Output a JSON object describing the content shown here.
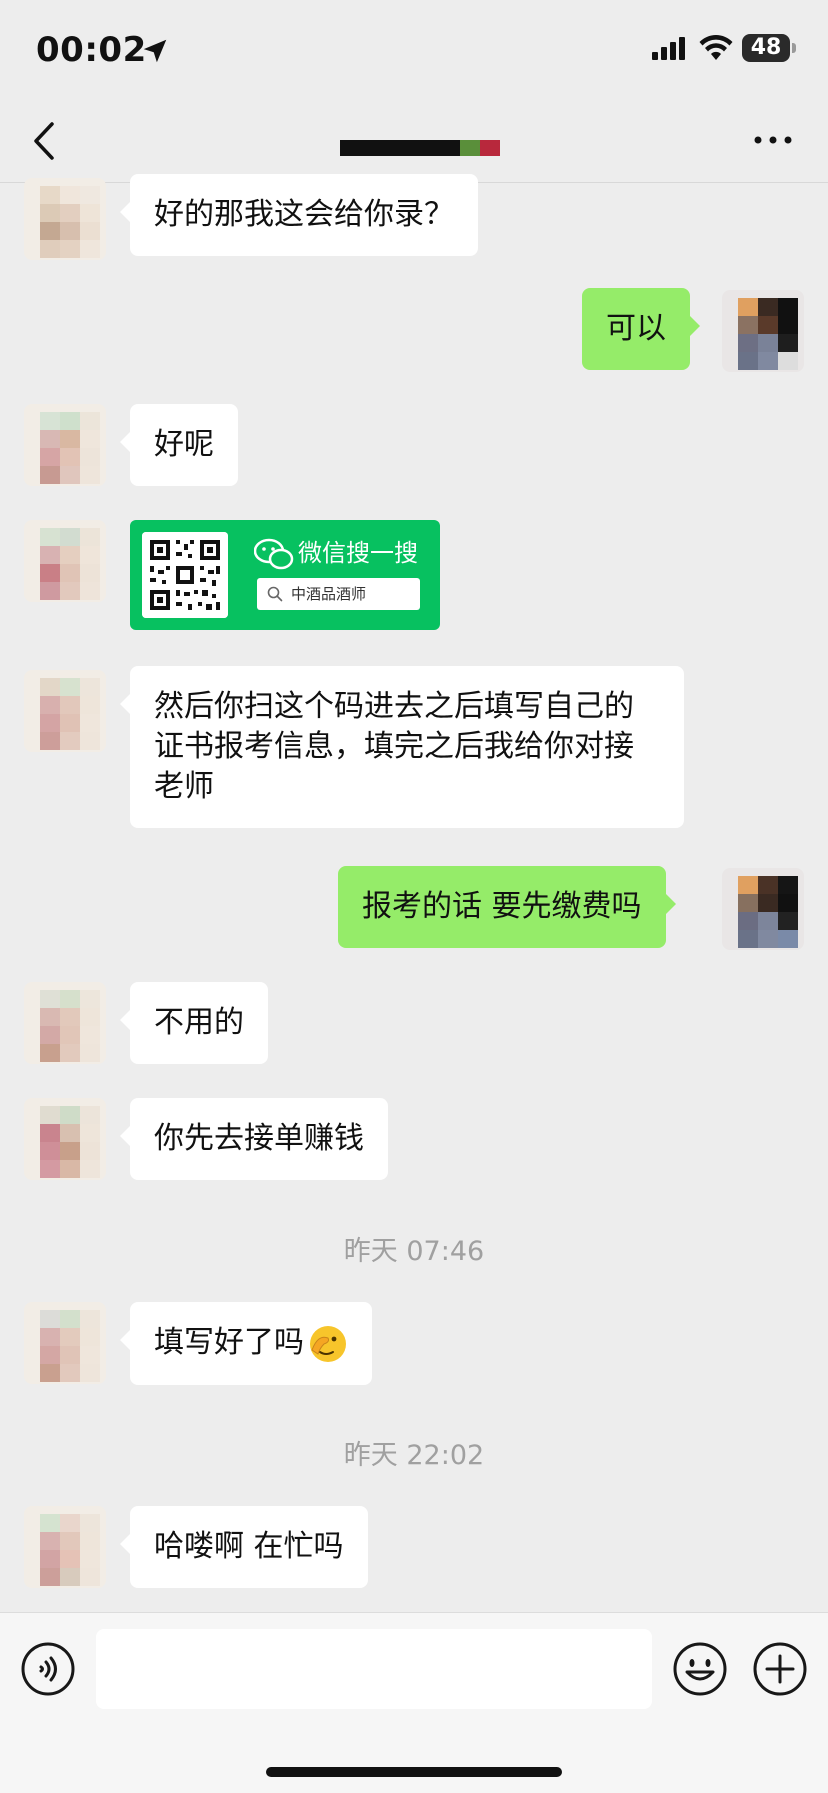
{
  "status_bar": {
    "time": "00:02",
    "battery": "48"
  },
  "nav": {
    "back_icon": "chevron-left-icon",
    "more_icon": "more-dots-icon",
    "title_redacted": true
  },
  "messages": [
    {
      "side": "in",
      "text": "好的那我这会给你录？"
    },
    {
      "side": "out",
      "text": "可以"
    },
    {
      "side": "in",
      "text": "好呢"
    },
    {
      "side": "in",
      "type": "card",
      "card_title": "微信搜一搜",
      "card_search": "中酒品酒师"
    },
    {
      "side": "in",
      "text": "然后你扫这个码进去之后填写自己的证书报考信息，填完之后我给你对接老师"
    },
    {
      "side": "out",
      "text": "报考的话 要先缴费吗"
    },
    {
      "side": "in",
      "text": "不用的"
    },
    {
      "side": "in",
      "text": "你先去接单赚钱"
    },
    {
      "type": "timestamp",
      "text": "昨天 07:46"
    },
    {
      "side": "in",
      "text": "填写好了吗",
      "emoji": "peeking-face-emoji"
    },
    {
      "type": "timestamp",
      "text": "昨天 22:02"
    },
    {
      "side": "in",
      "text": "哈喽啊 在忙吗"
    }
  ],
  "input_bar": {
    "voice_icon": "voice-icon",
    "emoji_icon": "smiley-icon",
    "plus_icon": "plus-circle-icon",
    "input_value": ""
  },
  "colors": {
    "background": "#ededed",
    "outgoing_bubble": "#95ec69",
    "incoming_bubble": "#ffffff",
    "card": "#07c160",
    "timestamp": "#a0a0a0"
  }
}
